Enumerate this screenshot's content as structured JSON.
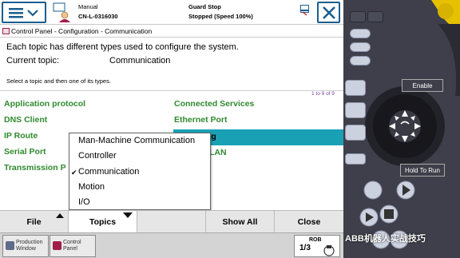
{
  "header": {
    "mode": "Manual",
    "controller": "CN-L-0316030",
    "safety_state": "Guard Stop",
    "motor_state": "Stopped (Speed 100%)"
  },
  "breadcrumb": "Control Panel - Configuration - Communication",
  "description": "Each topic has different types used to configure the system.",
  "current_topic_label": "Current topic:",
  "current_topic_value": "Communication",
  "hint": "Select a topic and then one of its types.",
  "count": "1 to 9 of 9",
  "types": {
    "col1": [
      "Application protocol",
      "DNS Client",
      "IP Route",
      "Serial Port",
      "Transmission P"
    ],
    "col2": [
      "Connected Services",
      "Ethernet Port",
      "ng",
      "LAN"
    ]
  },
  "topics_menu": {
    "options": [
      "Man-Machine Communication",
      "Controller",
      "Communication",
      "Motion",
      "I/O"
    ],
    "checked": "Communication",
    "check_mark": "✔"
  },
  "bottom_bar": {
    "file": "File",
    "topics": "Topics",
    "show_all": "Show All",
    "close": "Close"
  },
  "taskbar": {
    "production_window_1": "Production",
    "production_window_2": "Window",
    "control_panel_1": "Control",
    "control_panel_2": "Panel",
    "rob": "ROB",
    "rob_fraction": "1/3"
  },
  "pendant": {
    "enable": "Enable",
    "hold_to_run": "Hold To Run"
  },
  "watermark": "ABB机器人实战技巧",
  "colors": {
    "accent_blue": "#1b5e8f",
    "item_green": "#2f8a2f",
    "selection_teal": "#1aa0b5"
  }
}
